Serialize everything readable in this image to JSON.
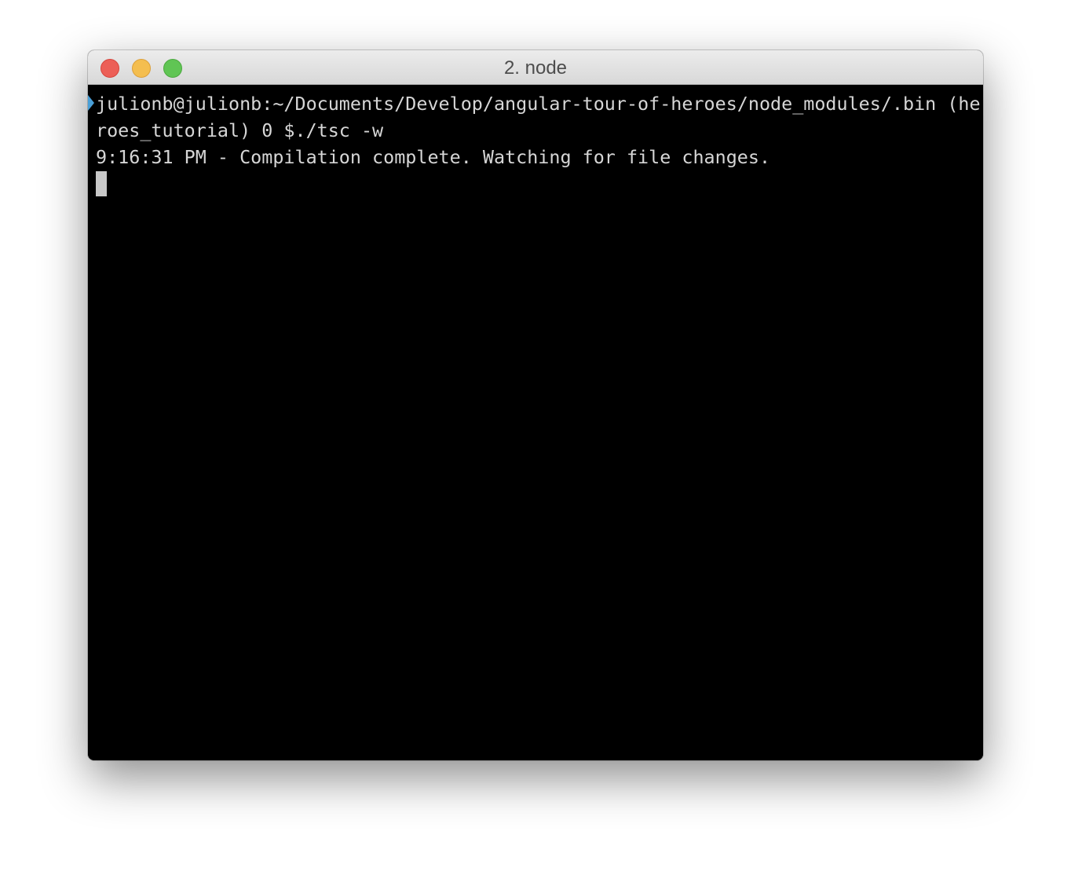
{
  "window": {
    "title": "2. node"
  },
  "colors": {
    "close": "#ec5f57",
    "minimize": "#f4be4f",
    "zoom": "#60c554",
    "terminal_background": "#000000",
    "terminal_text": "#d6d6d6",
    "mark_indicator": "#4aa0d8"
  },
  "terminal": {
    "lines": [
      "julionb@julionb:~/Documents/Develop/angular-tour-of-heroes/node_modules/.bin (he",
      "roes_tutorial) 0 $./tsc -w",
      "9:16:31 PM - Compilation complete. Watching for file changes."
    ]
  },
  "icons": {
    "close": "close-button",
    "minimize": "minimize-button",
    "zoom": "zoom-button",
    "mark": "command-mark-icon",
    "cursor": "text-cursor"
  }
}
